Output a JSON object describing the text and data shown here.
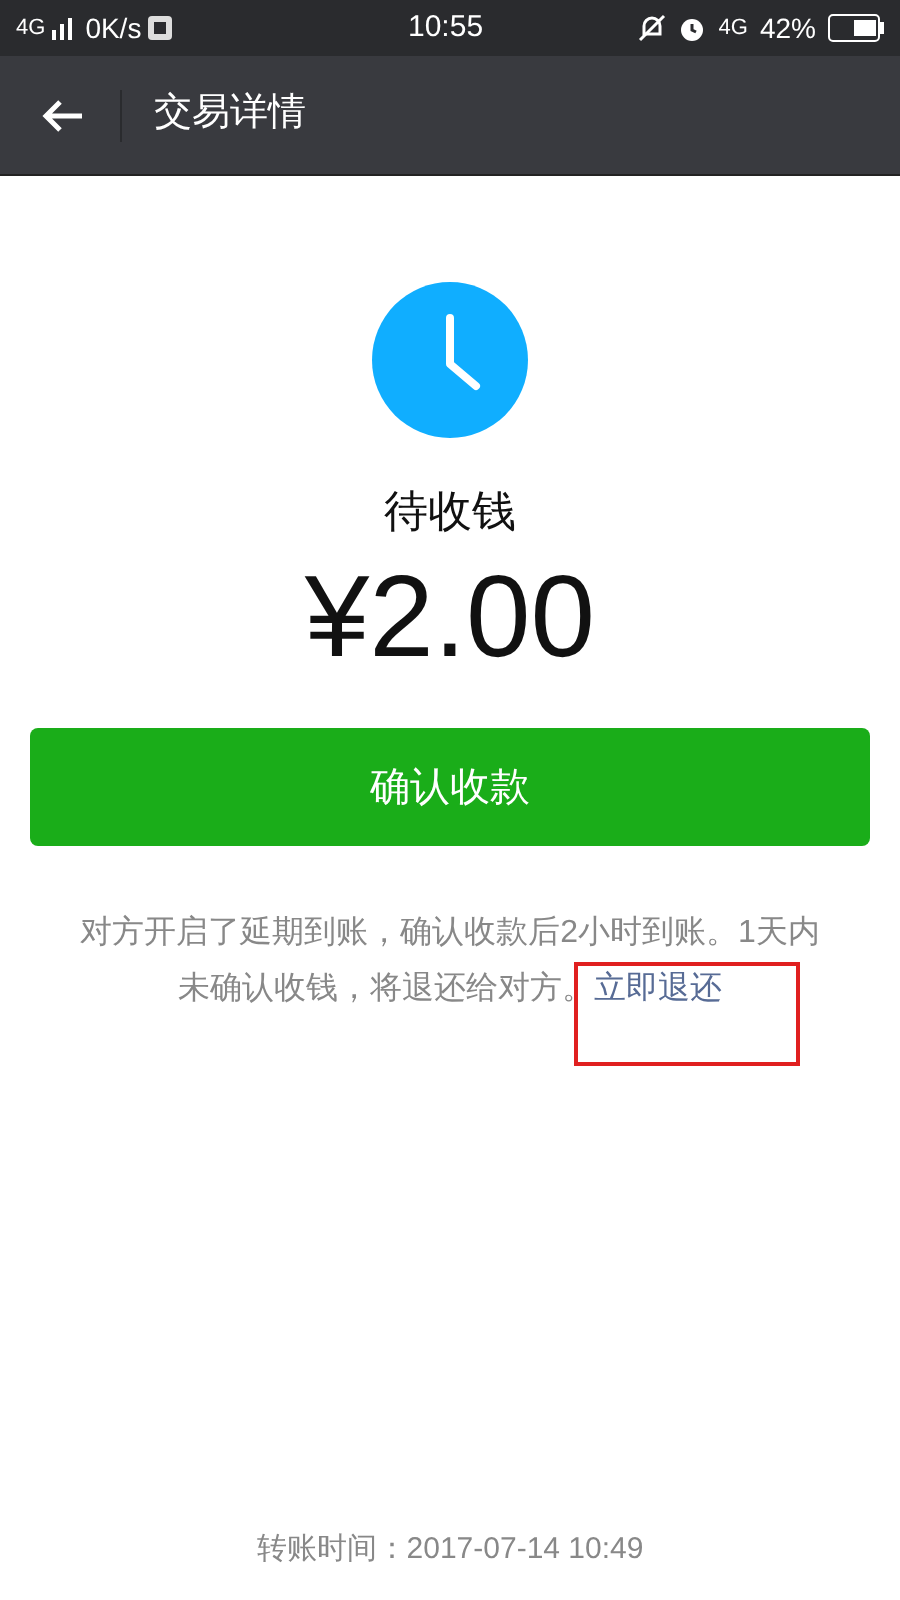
{
  "status_bar": {
    "network": "4G",
    "speed": "0K/s",
    "time": "10:55",
    "network_right": "4G",
    "battery": "42%"
  },
  "nav_bar": {
    "title": "交易详情"
  },
  "status": {
    "label": "待收钱",
    "amount": "¥2.00"
  },
  "confirm_button": {
    "label": "确认收款"
  },
  "note": {
    "text": "对方开启了延期到账，确认收款后2小时到账。1天内未确认收钱，将退还给对方。",
    "link": "立即退还",
    "link_highlighted": true
  },
  "transfer_time": "转账时间：2017-07-14 10:49"
}
